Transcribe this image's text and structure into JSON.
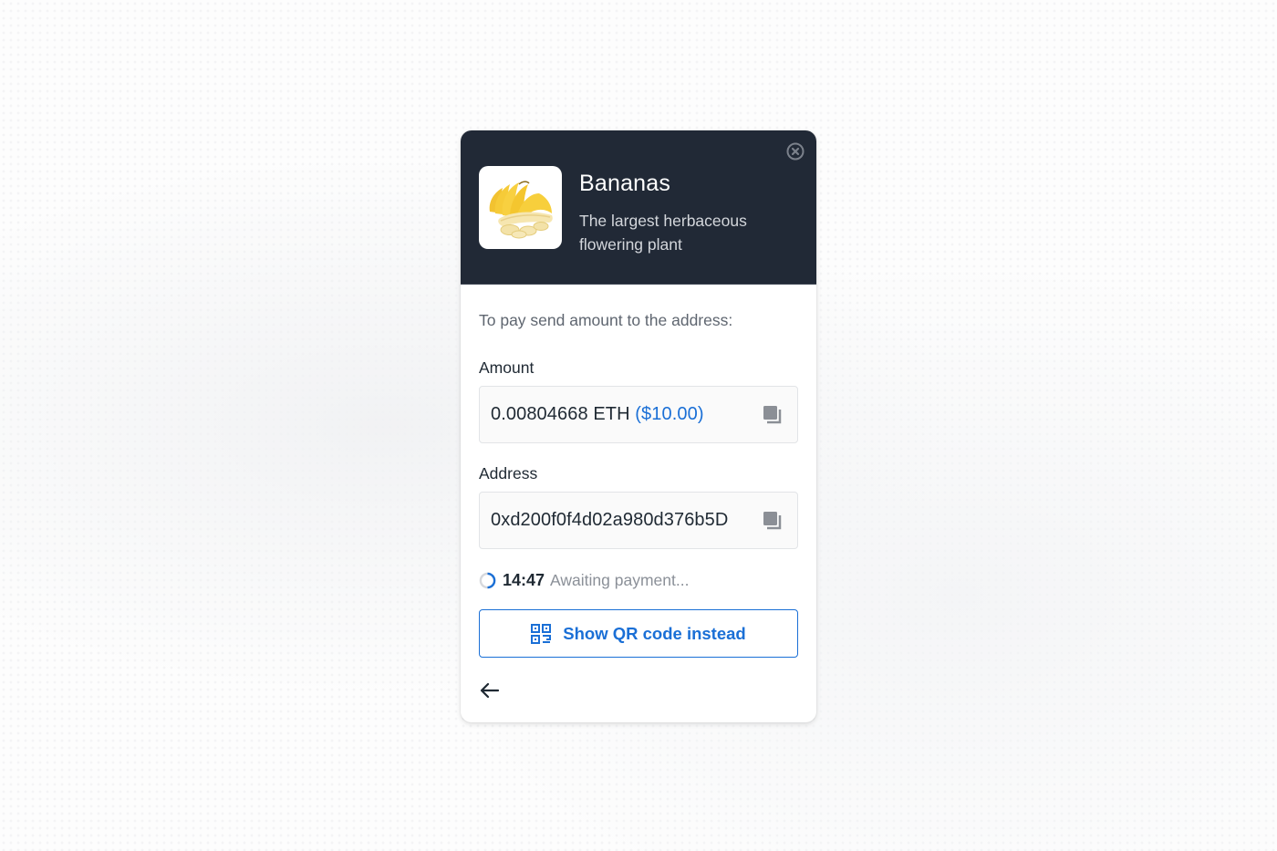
{
  "product": {
    "title": "Bananas",
    "description": "The largest herbaceous flowering plant",
    "image_icon": "banana-image"
  },
  "header": {
    "close_icon": "close-circle-icon"
  },
  "payment": {
    "instructions": "To pay send amount to the address:",
    "amount": {
      "label": "Amount",
      "crypto_value": "0.00804668 ETH",
      "fiat_value": "($10.00)",
      "copy_icon": "copy-icon"
    },
    "address": {
      "label": "Address",
      "value": "0xd200f0f4d02a980d376b5D",
      "copy_icon": "copy-icon"
    },
    "status": {
      "timer": "14:47",
      "text": "Awaiting payment...",
      "spinner_icon": "loading-spinner-icon"
    },
    "qr_button": {
      "label": "Show QR code instead",
      "icon": "qr-code-icon"
    },
    "back_icon": "arrow-left-icon"
  },
  "colors": {
    "header_bg": "#212936",
    "accent": "#1a6fd6",
    "text_primary": "#1f2933",
    "text_muted": "#8b9098"
  }
}
